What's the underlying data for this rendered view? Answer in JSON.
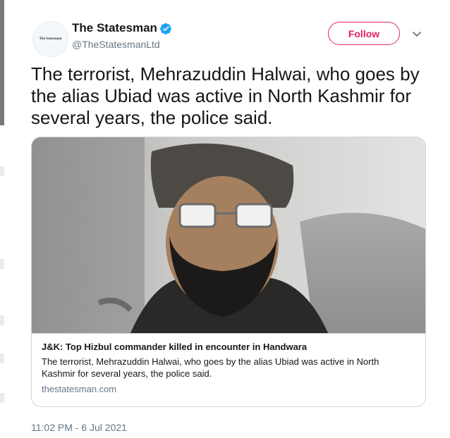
{
  "author": {
    "display_name": "The Statesman",
    "handle": "@TheStatesmanLtd",
    "avatar_text": "The Statesman",
    "verified": true
  },
  "follow_label": "Follow",
  "tweet_text": "The terrorist, Mehrazuddin Halwai, who goes by the alias Ubiad was active in North Kashmir for several years, the police said.",
  "card": {
    "title": "J&K: Top Hizbul commander killed in encounter in Handwara",
    "description": "The terrorist, Mehrazuddin Halwai, who goes by the alias Ubiad was active in North Kashmir for several years, the police said.",
    "domain": "thestatesman.com"
  },
  "timestamp": "11:02 PM - 6 Jul 2021",
  "colors": {
    "follow_accent": "#e0245e",
    "verified_blue": "#1da1f2",
    "secondary_text": "#657786",
    "border": "#ccd6dd"
  },
  "icons": {
    "verified": "verified-badge-icon",
    "caret": "chevron-down-icon"
  }
}
